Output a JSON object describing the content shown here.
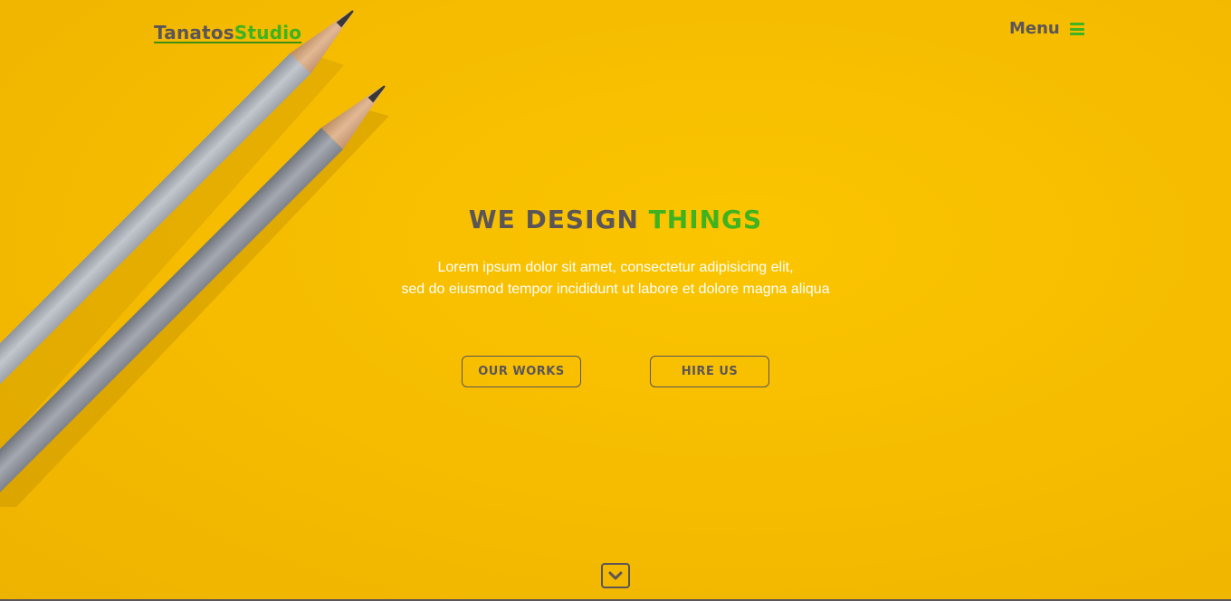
{
  "brand": {
    "part1": "Tanatos",
    "part2": "Studio"
  },
  "nav": {
    "menu_label": "Menu",
    "menu_icon": "hamburger-icon"
  },
  "hero": {
    "headline_part1": "WE DESIGN",
    "headline_part2": "THINGS",
    "subtitle_line1": "Lorem ipsum dolor sit amet, consectetur adipisicing elit,",
    "subtitle_line2": "sed do eiusmod tempor incididunt ut labore et dolore magna aliqua",
    "buttons": {
      "works": "OUR WORKS",
      "hire": "HIRE US"
    },
    "scroll_icon": "chevron-down-icon",
    "background_image": "pencils-photo"
  },
  "colors": {
    "background": "#f5bd02",
    "text_dark": "#5b5558",
    "accent_green": "#3eb31f",
    "subtitle": "#ffffff"
  }
}
